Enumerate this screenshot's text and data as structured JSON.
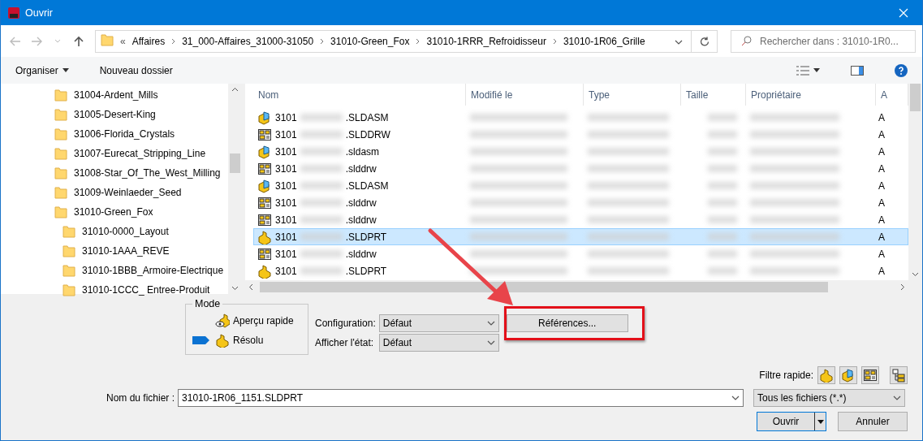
{
  "window": {
    "title": "Ouvrir"
  },
  "address": {
    "overflow": "«",
    "crumbs": [
      "Affaires",
      "31_000-Affaires_31000-31050",
      "31010-Green_Fox",
      "31010-1RRR_Refroidisseur",
      "31010-1R06_Grille"
    ]
  },
  "search": {
    "placeholder": "Rechercher dans : 31010-1R0..."
  },
  "toolbar": {
    "organize": "Organiser",
    "new_folder": "Nouveau dossier"
  },
  "tree": [
    {
      "label": "31004-Ardent_Mills"
    },
    {
      "label": "31005-Desert-King"
    },
    {
      "label": "31006-Florida_Crystals"
    },
    {
      "label": "31007-Eurecat_Stripping_Line"
    },
    {
      "label": "31008-Star_Of_The_West_Milling"
    },
    {
      "label": "31009-Weinlaeder_Seed"
    },
    {
      "label": "31010-Green_Fox",
      "children": [
        {
          "label": "31010-0000_Layout"
        },
        {
          "label": "31010-1AAA_REVE"
        },
        {
          "label": "31010-1BBB_Armoire-Electrique"
        },
        {
          "label": "31010-1CCC_ Entree-Produit"
        }
      ]
    }
  ],
  "table": {
    "columns": [
      "Nom",
      "Modifié le",
      "Type",
      "Taille",
      "Propriétaire",
      "A"
    ],
    "rows": [
      {
        "kind": "assembly",
        "name_start": "3101",
        "name_end": ".SLDASM",
        "column_6": "A",
        "selected": false
      },
      {
        "kind": "drawing",
        "name_start": "3101",
        "name_end": ".SLDDRW",
        "column_6": "A",
        "selected": false
      },
      {
        "kind": "assembly",
        "name_start": "3101",
        "name_end": ".sldasm",
        "column_6": "A",
        "selected": false
      },
      {
        "kind": "drawing",
        "name_start": "3101",
        "name_end": ".slddrw",
        "column_6": "A",
        "selected": false
      },
      {
        "kind": "assembly",
        "name_start": "3101",
        "name_end": ".SLDASM",
        "column_6": "A",
        "selected": false
      },
      {
        "kind": "drawing",
        "name_start": "3101",
        "name_end": ".slddrw",
        "column_6": "A",
        "selected": false
      },
      {
        "kind": "drawing",
        "name_start": "3101",
        "name_end": ".slddrw",
        "column_6": "A",
        "selected": false
      },
      {
        "kind": "part",
        "name_start": "3101",
        "name_end": ".SLDPRT",
        "column_6": "A",
        "selected": true
      },
      {
        "kind": "drawing",
        "name_start": "3101",
        "name_end": ".slddrw",
        "column_6": "A",
        "selected": false
      },
      {
        "kind": "part",
        "name_start": "3101",
        "name_end": ".SLDPRT",
        "column_6": "A",
        "selected": false
      }
    ]
  },
  "mode": {
    "title": "Mode",
    "options": [
      {
        "label": "Aperçu rapide",
        "kind": "preview",
        "selected": false
      },
      {
        "label": "Résolu",
        "kind": "resolved",
        "selected": true
      }
    ]
  },
  "configuration": {
    "label": "Configuration:",
    "value": "Défaut"
  },
  "display_state": {
    "label": "Afficher l'état:",
    "value": "Défaut"
  },
  "references_button": "Références...",
  "quick_filter": {
    "label": "Filtre rapide:",
    "filters": [
      {
        "kind": "part"
      },
      {
        "kind": "assembly"
      },
      {
        "kind": "drawing"
      },
      {
        "kind": "top-level"
      }
    ]
  },
  "file_name": {
    "label": "Nom du fichier :",
    "value": "31010-1R06_1151.SLDPRT"
  },
  "file_type": {
    "value": "Tous les fichiers (*.*)"
  },
  "buttons": {
    "open": "Ouvrir",
    "cancel": "Annuler"
  }
}
